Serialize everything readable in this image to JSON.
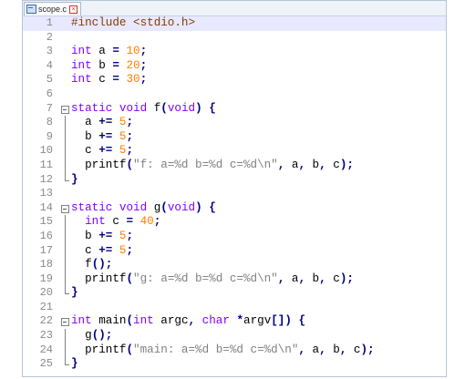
{
  "editor": {
    "tab": {
      "filename": "scope.c",
      "close": "×"
    },
    "current_line": 1,
    "lines": [
      {
        "num": "1",
        "fold": "none",
        "html": "<span class=\"pre\">#include &lt;stdio.h&gt;</span>"
      },
      {
        "num": "2",
        "fold": "none",
        "html": ""
      },
      {
        "num": "3",
        "fold": "none",
        "html": "<span class=\"kw\">int</span> a <span class=\"op\">=</span> <span class=\"num\">10</span><span class=\"op\">;</span>"
      },
      {
        "num": "4",
        "fold": "none",
        "html": "<span class=\"kw\">int</span> b <span class=\"op\">=</span> <span class=\"num\">20</span><span class=\"op\">;</span>"
      },
      {
        "num": "5",
        "fold": "none",
        "html": "<span class=\"kw\">int</span> c <span class=\"op\">=</span> <span class=\"num\">30</span><span class=\"op\">;</span>"
      },
      {
        "num": "6",
        "fold": "none",
        "html": ""
      },
      {
        "num": "7",
        "fold": "box",
        "html": "<span class=\"kw\">static</span> <span class=\"kw\">void</span> f<span class=\"op\">(</span><span class=\"kw\">void</span><span class=\"op\">)</span> <span class=\"op\">{</span>"
      },
      {
        "num": "8",
        "fold": "bar",
        "html": "  a <span class=\"op\">+=</span> <span class=\"num\">5</span><span class=\"op\">;</span>"
      },
      {
        "num": "9",
        "fold": "bar",
        "html": "  b <span class=\"op\">+=</span> <span class=\"num\">5</span><span class=\"op\">;</span>"
      },
      {
        "num": "10",
        "fold": "bar",
        "html": "  c <span class=\"op\">+=</span> <span class=\"num\">5</span><span class=\"op\">;</span>"
      },
      {
        "num": "11",
        "fold": "bar",
        "html": "  printf<span class=\"op\">(</span><span class=\"str\">\"f: a=%d b=%d c=%d\\n\"</span><span class=\"op\">,</span> a<span class=\"op\">,</span> b<span class=\"op\">,</span> c<span class=\"op\">);</span>"
      },
      {
        "num": "12",
        "fold": "end",
        "html": "<span class=\"op\">}</span>"
      },
      {
        "num": "13",
        "fold": "none",
        "html": ""
      },
      {
        "num": "14",
        "fold": "box",
        "html": "<span class=\"kw\">static</span> <span class=\"kw\">void</span> g<span class=\"op\">(</span><span class=\"kw\">void</span><span class=\"op\">)</span> <span class=\"op\">{</span>"
      },
      {
        "num": "15",
        "fold": "bar",
        "html": "  <span class=\"kw\">int</span> c <span class=\"op\">=</span> <span class=\"num\">40</span><span class=\"op\">;</span>"
      },
      {
        "num": "16",
        "fold": "bar",
        "html": "  b <span class=\"op\">+=</span> <span class=\"num\">5</span><span class=\"op\">;</span>"
      },
      {
        "num": "17",
        "fold": "bar",
        "html": "  c <span class=\"op\">+=</span> <span class=\"num\">5</span><span class=\"op\">;</span>"
      },
      {
        "num": "18",
        "fold": "bar",
        "html": "  f<span class=\"op\">();</span>"
      },
      {
        "num": "19",
        "fold": "bar",
        "html": "  printf<span class=\"op\">(</span><span class=\"str\">\"g: a=%d b=%d c=%d\\n\"</span><span class=\"op\">,</span> a<span class=\"op\">,</span> b<span class=\"op\">,</span> c<span class=\"op\">);</span>"
      },
      {
        "num": "20",
        "fold": "end",
        "html": "<span class=\"op\">}</span>"
      },
      {
        "num": "21",
        "fold": "none",
        "html": ""
      },
      {
        "num": "22",
        "fold": "box",
        "html": "<span class=\"kw\">int</span> main<span class=\"op\">(</span><span class=\"kw\">int</span> argc<span class=\"op\">,</span> <span class=\"kw\">char</span> <span class=\"op\">*</span>argv<span class=\"op\">[])</span> <span class=\"op\">{</span>"
      },
      {
        "num": "23",
        "fold": "bar",
        "html": "  g<span class=\"op\">();</span>"
      },
      {
        "num": "24",
        "fold": "bar",
        "html": "  printf<span class=\"op\">(</span><span class=\"str\">\"main: a=%d b=%d c=%d\\n\"</span><span class=\"op\">,</span> a<span class=\"op\">,</span> b<span class=\"op\">,</span> c<span class=\"op\">);</span>"
      },
      {
        "num": "25",
        "fold": "end",
        "html": "<span class=\"op\">}</span>"
      }
    ]
  }
}
